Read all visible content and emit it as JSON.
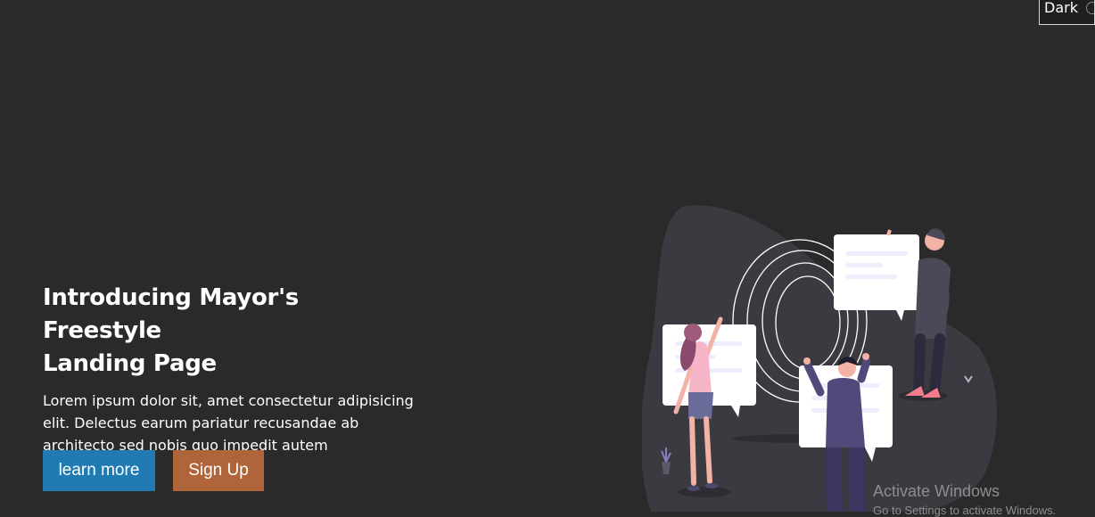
{
  "theme_toggle": {
    "label": "Dark",
    "icon": "moon-icon"
  },
  "hero": {
    "title_line1": "Introducing Mayor's Freestyle",
    "title_line2": "Landing Page",
    "desc_line1": "Lorem ipsum dolor sit, amet consectetur adipisicing",
    "desc_line2": "elit. Delectus earum pariatur recusandae ab",
    "desc_line3": "architecto sed nobis quo impedit autem consectetur."
  },
  "buttons": {
    "learn_more": "learn more",
    "sign_up": "Sign Up"
  },
  "watermark": {
    "title": "Activate Windows",
    "subtitle": "Go to Settings to activate Windows."
  },
  "colors": {
    "background": "#2a2a2a",
    "learn_more": "#1f7bb1",
    "sign_up": "#b0643a",
    "accent_pink": "#f47c8c"
  }
}
